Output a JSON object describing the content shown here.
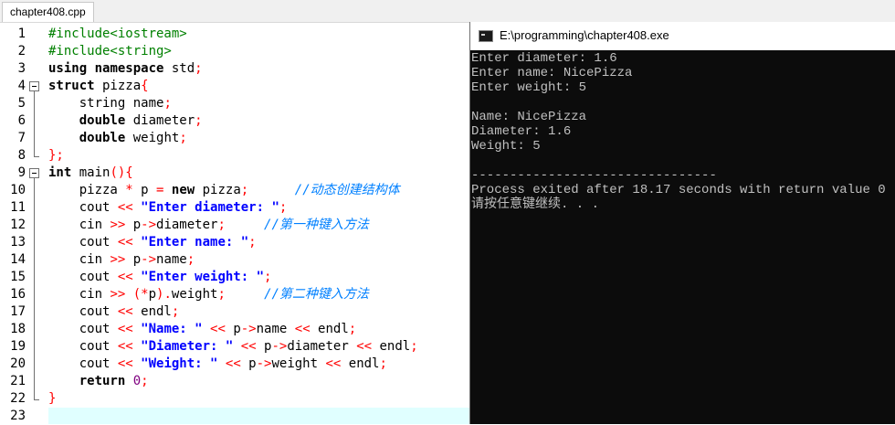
{
  "tab": {
    "title": "chapter408.cpp"
  },
  "line_numbers": [
    "1",
    "2",
    "3",
    "4",
    "5",
    "6",
    "7",
    "8",
    "9",
    "10",
    "11",
    "12",
    "13",
    "14",
    "15",
    "16",
    "17",
    "18",
    "19",
    "20",
    "21",
    "22",
    "23"
  ],
  "code_lines": [
    [
      {
        "t": "#include<iostream>",
        "c": "pp"
      }
    ],
    [
      {
        "t": "#include<string>",
        "c": "pp"
      }
    ],
    [
      {
        "t": "using",
        "c": "kw"
      },
      {
        "t": " "
      },
      {
        "t": "namespace",
        "c": "kw"
      },
      {
        "t": " std"
      },
      {
        "t": ";",
        "c": "op"
      }
    ],
    [
      {
        "t": "struct",
        "c": "kw"
      },
      {
        "t": " pizza"
      },
      {
        "t": "{",
        "c": "op"
      }
    ],
    [
      {
        "t": "    string name"
      },
      {
        "t": ";",
        "c": "op"
      }
    ],
    [
      {
        "t": "    "
      },
      {
        "t": "double",
        "c": "kw"
      },
      {
        "t": " diameter"
      },
      {
        "t": ";",
        "c": "op"
      }
    ],
    [
      {
        "t": "    "
      },
      {
        "t": "double",
        "c": "kw"
      },
      {
        "t": " weight"
      },
      {
        "t": ";",
        "c": "op"
      }
    ],
    [
      {
        "t": "};",
        "c": "op"
      }
    ],
    [
      {
        "t": "int",
        "c": "kw"
      },
      {
        "t": " main"
      },
      {
        "t": "(){",
        "c": "op"
      }
    ],
    [
      {
        "t": "    pizza "
      },
      {
        "t": "*",
        "c": "op"
      },
      {
        "t": " p "
      },
      {
        "t": "=",
        "c": "op"
      },
      {
        "t": " "
      },
      {
        "t": "new",
        "c": "kw"
      },
      {
        "t": " pizza"
      },
      {
        "t": ";",
        "c": "op"
      },
      {
        "t": "      "
      },
      {
        "t": "//动态创建结构体",
        "c": "cm"
      }
    ],
    [
      {
        "t": "    cout "
      },
      {
        "t": "<<",
        "c": "op"
      },
      {
        "t": " "
      },
      {
        "t": "\"Enter diameter: \"",
        "c": "st"
      },
      {
        "t": ";",
        "c": "op"
      }
    ],
    [
      {
        "t": "    cin "
      },
      {
        "t": ">>",
        "c": "op"
      },
      {
        "t": " p"
      },
      {
        "t": "->",
        "c": "op"
      },
      {
        "t": "diameter"
      },
      {
        "t": ";",
        "c": "op"
      },
      {
        "t": "     "
      },
      {
        "t": "//第一种键入方法",
        "c": "cm"
      }
    ],
    [
      {
        "t": "    cout "
      },
      {
        "t": "<<",
        "c": "op"
      },
      {
        "t": " "
      },
      {
        "t": "\"Enter name: \"",
        "c": "st"
      },
      {
        "t": ";",
        "c": "op"
      }
    ],
    [
      {
        "t": "    cin "
      },
      {
        "t": ">>",
        "c": "op"
      },
      {
        "t": " p"
      },
      {
        "t": "->",
        "c": "op"
      },
      {
        "t": "name"
      },
      {
        "t": ";",
        "c": "op"
      }
    ],
    [
      {
        "t": "    cout "
      },
      {
        "t": "<<",
        "c": "op"
      },
      {
        "t": " "
      },
      {
        "t": "\"Enter weight: \"",
        "c": "st"
      },
      {
        "t": ";",
        "c": "op"
      }
    ],
    [
      {
        "t": "    cin "
      },
      {
        "t": ">>",
        "c": "op"
      },
      {
        "t": " "
      },
      {
        "t": "(*",
        "c": "op"
      },
      {
        "t": "p"
      },
      {
        "t": ").",
        "c": "op"
      },
      {
        "t": "weight"
      },
      {
        "t": ";",
        "c": "op"
      },
      {
        "t": "     "
      },
      {
        "t": "//第二种键入方法",
        "c": "cm"
      }
    ],
    [
      {
        "t": "    cout "
      },
      {
        "t": "<<",
        "c": "op"
      },
      {
        "t": " endl"
      },
      {
        "t": ";",
        "c": "op"
      }
    ],
    [
      {
        "t": "    cout "
      },
      {
        "t": "<<",
        "c": "op"
      },
      {
        "t": " "
      },
      {
        "t": "\"Name: \"",
        "c": "st"
      },
      {
        "t": " "
      },
      {
        "t": "<<",
        "c": "op"
      },
      {
        "t": " p"
      },
      {
        "t": "->",
        "c": "op"
      },
      {
        "t": "name "
      },
      {
        "t": "<<",
        "c": "op"
      },
      {
        "t": " endl"
      },
      {
        "t": ";",
        "c": "op"
      }
    ],
    [
      {
        "t": "    cout "
      },
      {
        "t": "<<",
        "c": "op"
      },
      {
        "t": " "
      },
      {
        "t": "\"Diameter: \"",
        "c": "st"
      },
      {
        "t": " "
      },
      {
        "t": "<<",
        "c": "op"
      },
      {
        "t": " p"
      },
      {
        "t": "->",
        "c": "op"
      },
      {
        "t": "diameter "
      },
      {
        "t": "<<",
        "c": "op"
      },
      {
        "t": " endl"
      },
      {
        "t": ";",
        "c": "op"
      }
    ],
    [
      {
        "t": "    cout "
      },
      {
        "t": "<<",
        "c": "op"
      },
      {
        "t": " "
      },
      {
        "t": "\"Weight: \"",
        "c": "st"
      },
      {
        "t": " "
      },
      {
        "t": "<<",
        "c": "op"
      },
      {
        "t": " p"
      },
      {
        "t": "->",
        "c": "op"
      },
      {
        "t": "weight "
      },
      {
        "t": "<<",
        "c": "op"
      },
      {
        "t": " endl"
      },
      {
        "t": ";",
        "c": "op"
      }
    ],
    [
      {
        "t": "    "
      },
      {
        "t": "return",
        "c": "kw"
      },
      {
        "t": " "
      },
      {
        "t": "0",
        "c": "nm"
      },
      {
        "t": ";",
        "c": "op"
      }
    ],
    [
      {
        "t": "}",
        "c": "op"
      }
    ],
    []
  ],
  "console": {
    "title": "E:\\programming\\chapter408.exe",
    "lines": [
      "Enter diameter: 1.6",
      "Enter name: NicePizza",
      "Enter weight: 5",
      "",
      "Name: NicePizza",
      "Diameter: 1.6",
      "Weight: 5",
      "",
      "--------------------------------",
      "Process exited after 18.17 seconds with return value 0",
      "请按任意键继续. . ."
    ]
  }
}
